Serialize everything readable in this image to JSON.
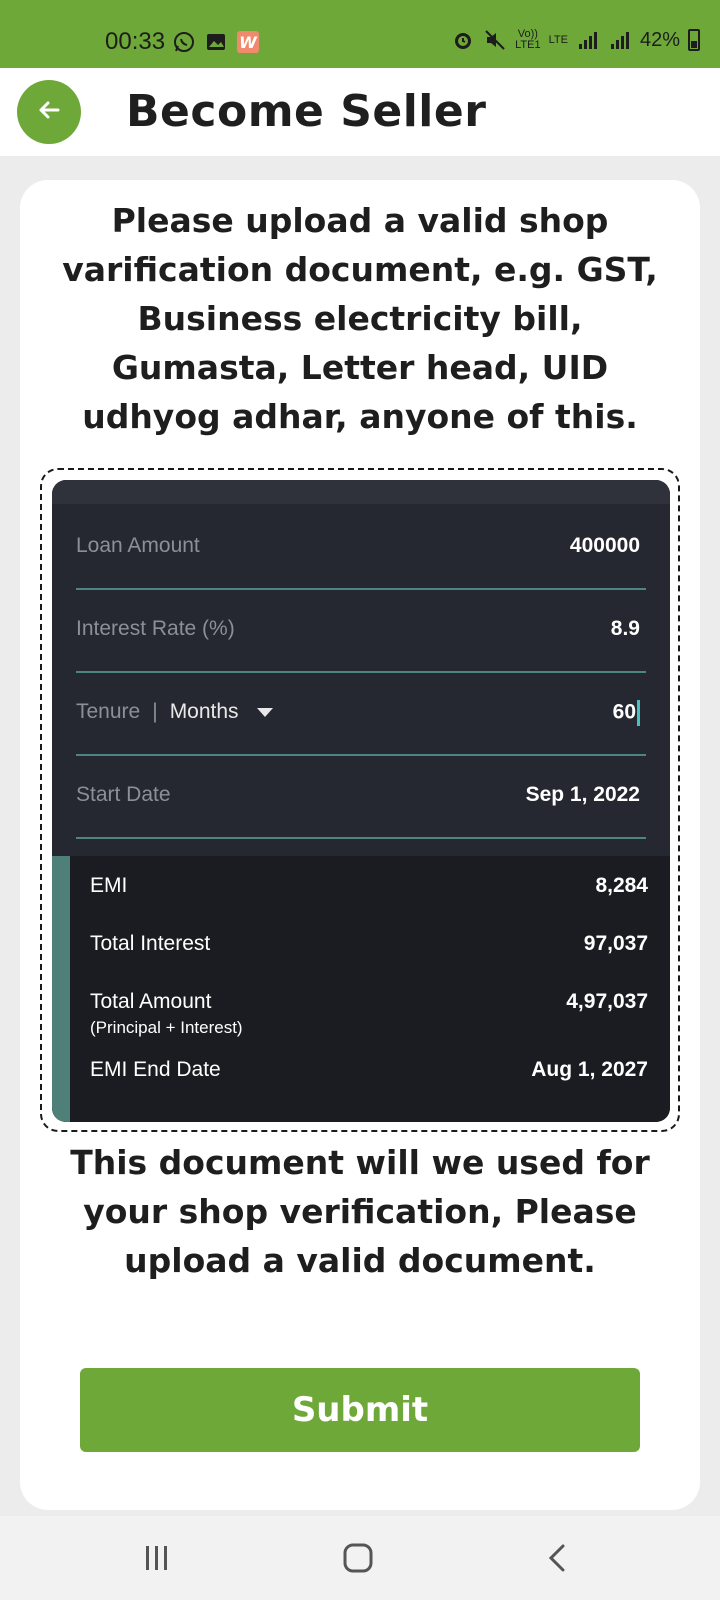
{
  "status_bar": {
    "time": "00:33",
    "battery": "42%",
    "volte_label_1": "Vo))\nLTE1",
    "lte_label": "LTE"
  },
  "app_bar": {
    "title": "Become Seller",
    "back_icon": "arrow-left-icon"
  },
  "instructions": "Please upload a valid shop varification document, e.g. GST, Business electricity bill, Gumasta, Letter head, UID udhyog adhar, anyone of this.",
  "preview": {
    "fields": [
      {
        "label": "Loan Amount",
        "value": "400000"
      },
      {
        "label": "Interest Rate (%)",
        "value": "8.9"
      },
      {
        "label": "Tenure",
        "unit": "Months",
        "value": "60"
      },
      {
        "label": "Start Date",
        "value": "Sep 1, 2022"
      }
    ],
    "results": [
      {
        "label": "EMI",
        "value": "8,284"
      },
      {
        "label": "Total Interest",
        "value": "97,037"
      },
      {
        "label": "Total Amount",
        "sub": "(Principal + Interest)",
        "value": "4,97,037"
      },
      {
        "label": "EMI End Date",
        "value": "Aug 1, 2027"
      }
    ]
  },
  "note": "This document will we used for your shop verification, Please upload a valid document.",
  "submit_label": "Submit",
  "colors": {
    "brand_green": "#6ea838",
    "preview_bg": "#252830",
    "results_bg": "#1b1c21",
    "accent_teal": "#4f7f79"
  }
}
